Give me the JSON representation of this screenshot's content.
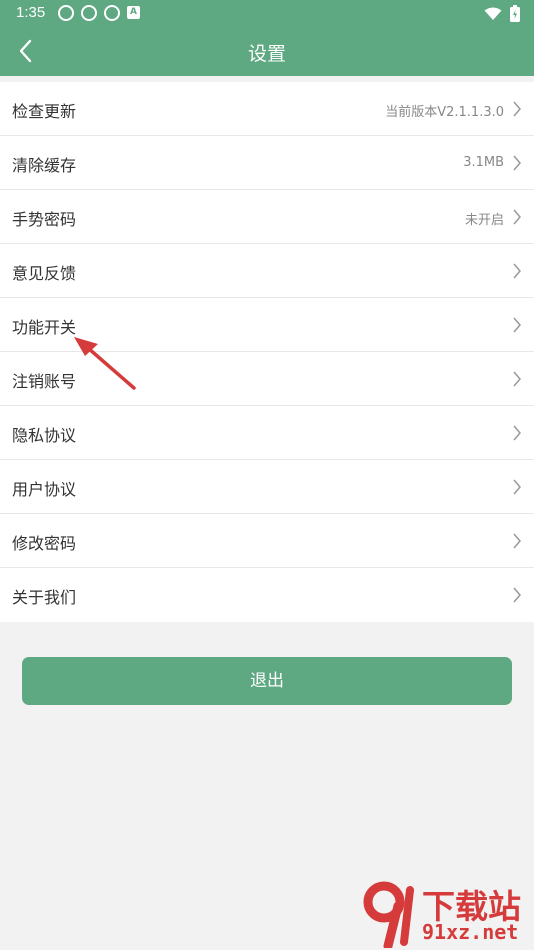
{
  "status_bar": {
    "time": "1:35",
    "a_label": "A"
  },
  "app_bar": {
    "title": "设置"
  },
  "settings": [
    {
      "label": "检查更新",
      "value": "当前版本V2.1.1.3.0"
    },
    {
      "label": "清除缓存",
      "value": "3.1MB"
    },
    {
      "label": "手势密码",
      "value": "未开启"
    },
    {
      "label": "意见反馈",
      "value": ""
    },
    {
      "label": "功能开关",
      "value": ""
    },
    {
      "label": "注销账号",
      "value": ""
    },
    {
      "label": "隐私协议",
      "value": ""
    },
    {
      "label": "用户协议",
      "value": ""
    },
    {
      "label": "修改密码",
      "value": ""
    },
    {
      "label": "关于我们",
      "value": ""
    }
  ],
  "logout_label": "退出",
  "watermark": {
    "top": "下载站",
    "bottom": "91xz.net"
  },
  "colors": {
    "brand": "#5ea882",
    "annotation": "#d63b3b"
  }
}
